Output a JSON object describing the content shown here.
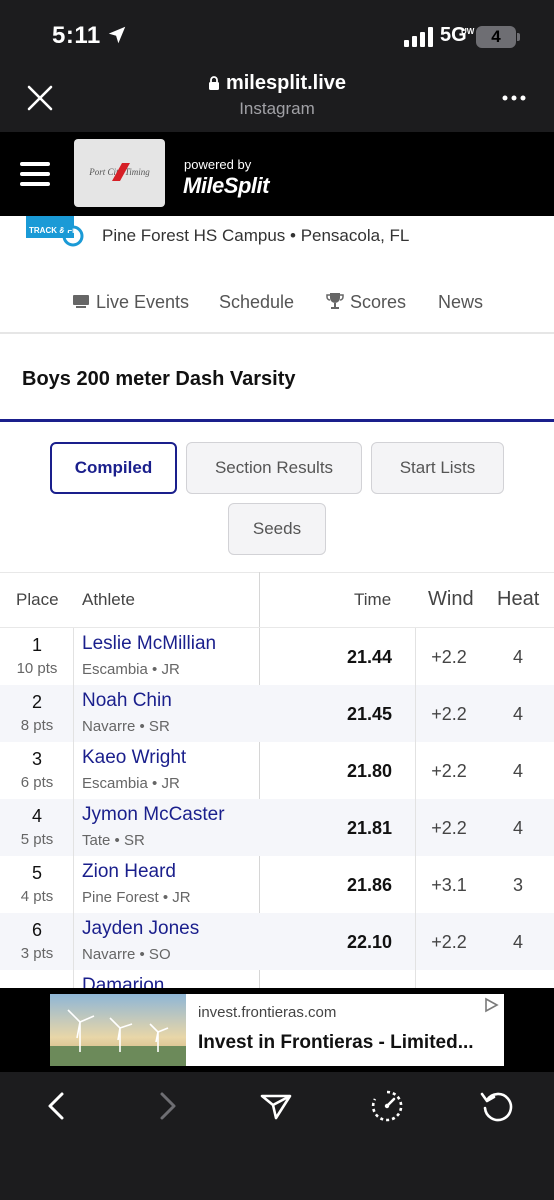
{
  "status_bar": {
    "time": "5:11",
    "network": "5G",
    "network_sub": "UW",
    "battery": "4"
  },
  "browser": {
    "url": "milesplit.live",
    "source": "Instagram"
  },
  "site_header": {
    "logo_text": "Port City Timing",
    "powered_by": "powered by",
    "brand": "MileSplit"
  },
  "meet": {
    "location": "Pine Forest HS Campus • Pensacola, FL",
    "logo_text": "TRACK & FIELD"
  },
  "nav_tabs": [
    {
      "label": "Live Events",
      "icon": "live-icon"
    },
    {
      "label": "Schedule"
    },
    {
      "label": "Scores",
      "icon": "trophy-icon"
    },
    {
      "label": "News"
    }
  ],
  "event": {
    "title": "Boys 200 meter Dash Varsity"
  },
  "filters": {
    "compiled": "Compiled",
    "section_results": "Section Results",
    "start_lists": "Start Lists",
    "seeds": "Seeds",
    "active": "Compiled"
  },
  "table": {
    "headers": {
      "place": "Place",
      "athlete": "Athlete",
      "time": "Time",
      "wind": "Wind",
      "heat": "Heat"
    },
    "rows": [
      {
        "place": "1",
        "pts": "10 pts",
        "name": "Leslie McMillian",
        "info": "Escambia • JR",
        "time": "21.44",
        "wind": "+2.2",
        "heat": "4"
      },
      {
        "place": "2",
        "pts": "8 pts",
        "name": "Noah Chin",
        "info": "Navarre • SR",
        "time": "21.45",
        "wind": "+2.2",
        "heat": "4"
      },
      {
        "place": "3",
        "pts": "6 pts",
        "name": "Kaeo Wright",
        "info": "Escambia • JR",
        "time": "21.80",
        "wind": "+2.2",
        "heat": "4"
      },
      {
        "place": "4",
        "pts": "5 pts",
        "name": "Jymon McCaster",
        "info": "Tate • SR",
        "time": "21.81",
        "wind": "+2.2",
        "heat": "4"
      },
      {
        "place": "5",
        "pts": "4 pts",
        "name": "Zion Heard",
        "info": "Pine Forest • JR",
        "time": "21.86",
        "wind": "+3.1",
        "heat": "3"
      },
      {
        "place": "6",
        "pts": "3 pts",
        "name": "Jayden Jones",
        "info": "Navarre • SO",
        "time": "22.10",
        "wind": "+2.2",
        "heat": "4"
      },
      {
        "place": "",
        "pts": "",
        "name": "Damarion",
        "info": "",
        "time": "",
        "wind": "",
        "heat": ""
      }
    ]
  },
  "ad": {
    "domain": "invest.frontieras.com",
    "headline": "Invest in Frontieras - Limited..."
  },
  "colors": {
    "accent": "#1a1f8c",
    "header_bg": "#000000",
    "chrome_bg": "#1c1c1e"
  }
}
